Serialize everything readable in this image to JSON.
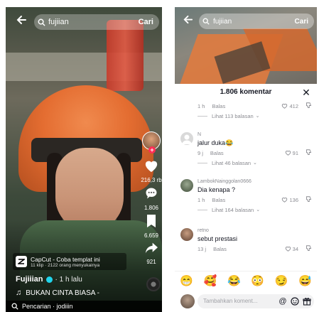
{
  "left": {
    "search": {
      "query": "fujiian",
      "submit": "Cari"
    },
    "rail": {
      "likes": "216,3 rb",
      "comments": "1.806",
      "saves": "6.659",
      "shares": "921"
    },
    "capcut": {
      "title": "CapCut - Coba templat ini",
      "sub": "11 klip · 2122 orang menyukainya"
    },
    "author": {
      "name": "Fujiiian",
      "ago": "· 1 h lalu"
    },
    "music": "BUKAN CINTA BIASA -",
    "bottom_search": "Pencarian · jodiiin"
  },
  "right": {
    "search": {
      "query": "fujiian",
      "submit": "Cari"
    },
    "sheet_title": "1.806 komentar",
    "comments": [
      {
        "user": "",
        "text": "",
        "ago": "1 h",
        "reply": "Balas",
        "likes": "412",
        "more": "Lihat 113 balasan",
        "avatar": "#cfcfcf"
      },
      {
        "user": "N",
        "text": "jalur duka😂",
        "ago": "9 j",
        "reply": "Balas",
        "likes": "91",
        "more": "Lihat 46 balasan",
        "avatar": "#d7d7d7"
      },
      {
        "user": "LambokNainggolan0666",
        "text": "Dia kenapa ?",
        "ago": "1 h",
        "reply": "Balas",
        "likes": "136",
        "more": "Lihat 164 balasan",
        "avatar": "#5f6f5b"
      },
      {
        "user": "retno",
        "text": "sebut prestasi",
        "ago": "13 j",
        "reply": "Balas",
        "likes": "34",
        "more": "",
        "avatar": "#8a6a55"
      }
    ],
    "emojis": [
      "😁",
      "🥰",
      "😂",
      "😳",
      "😏",
      "😅"
    ],
    "input_placeholder": "Tambahkan koment..."
  }
}
